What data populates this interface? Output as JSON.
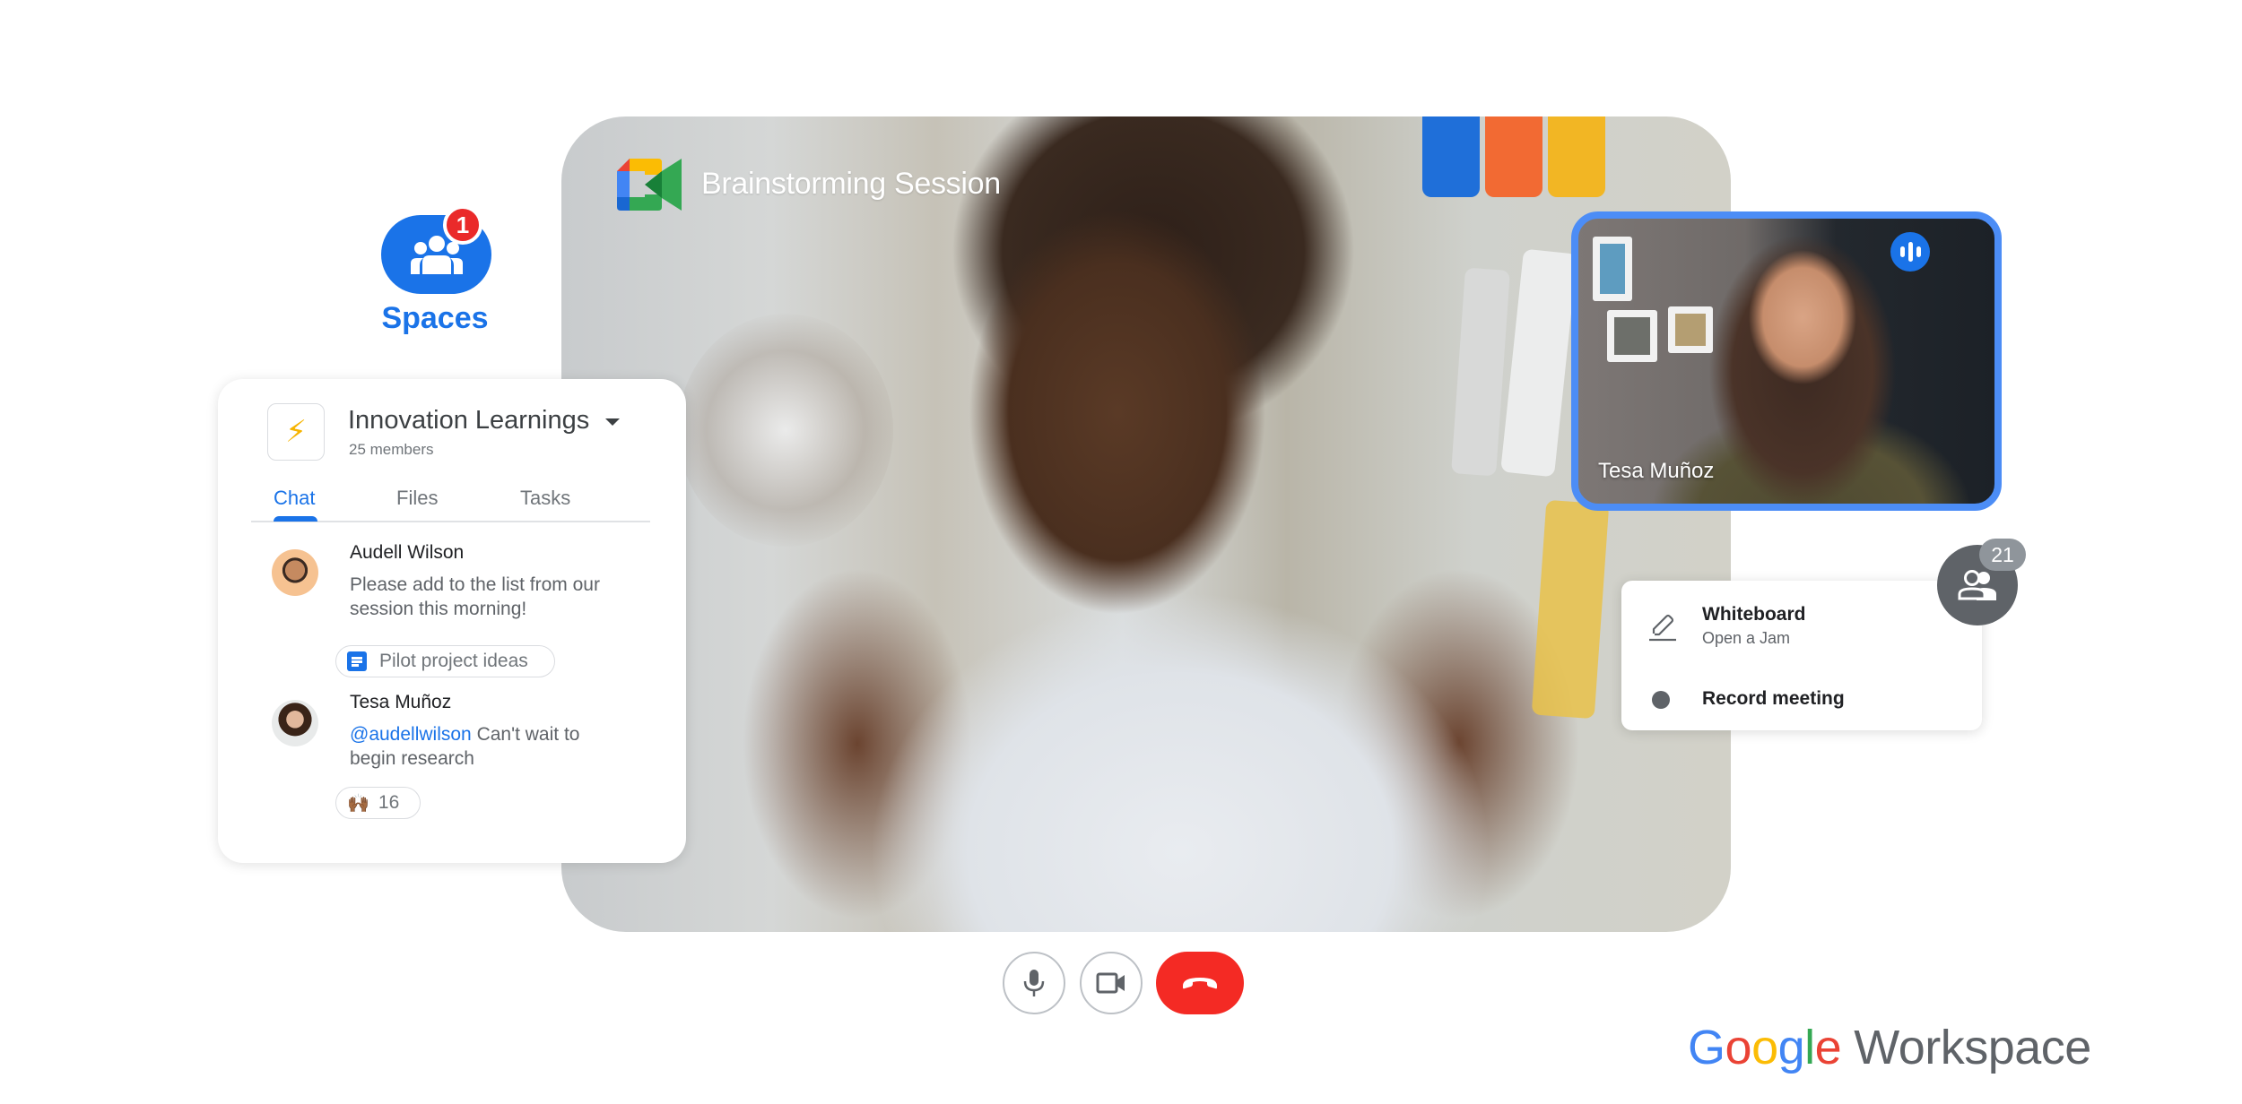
{
  "meeting": {
    "title": "Brainstorming Session",
    "logo": "google-meet-icon"
  },
  "spaces": {
    "label": "Spaces",
    "badge_count": "1",
    "icon": "group-icon"
  },
  "space_card": {
    "icon": "⚡",
    "name": "Innovation Learnings",
    "members": "25 members",
    "tabs": [
      {
        "label": "Chat",
        "active": true
      },
      {
        "label": "Files",
        "active": false
      },
      {
        "label": "Tasks",
        "active": false
      }
    ],
    "messages": [
      {
        "author": "Audell Wilson",
        "text": "Please add to the list from our session this morning!",
        "attachment": {
          "icon": "google-docs-icon",
          "label": "Pilot project ideas"
        }
      },
      {
        "author": "Tesa Muñoz",
        "mention": "@audellwilson",
        "text": " Can't wait to begin research",
        "reaction": {
          "emoji": "🙌🏾",
          "count": "16"
        }
      }
    ]
  },
  "participant_tile": {
    "name": "Tesa Muñoz",
    "speaking": true
  },
  "options_menu": {
    "items": [
      {
        "icon": "pencil-icon",
        "label": "Whiteboard",
        "sublabel": "Open a Jam"
      },
      {
        "icon": "record-icon",
        "label": "Record meeting"
      }
    ]
  },
  "participants": {
    "count": "21",
    "icon": "people-icon"
  },
  "controls": {
    "mic": "microphone-icon",
    "camera": "video-camera-icon",
    "end_call": "hang-up-icon"
  },
  "brand": {
    "google": [
      "G",
      "o",
      "o",
      "g",
      "l",
      "e"
    ],
    "product": "Workspace",
    "colors": {
      "blue": "#4285f4",
      "red": "#ea4335",
      "yellow": "#fbbc05",
      "green": "#34a853",
      "accent": "#1a73e8",
      "end_call": "#f42a24"
    }
  }
}
